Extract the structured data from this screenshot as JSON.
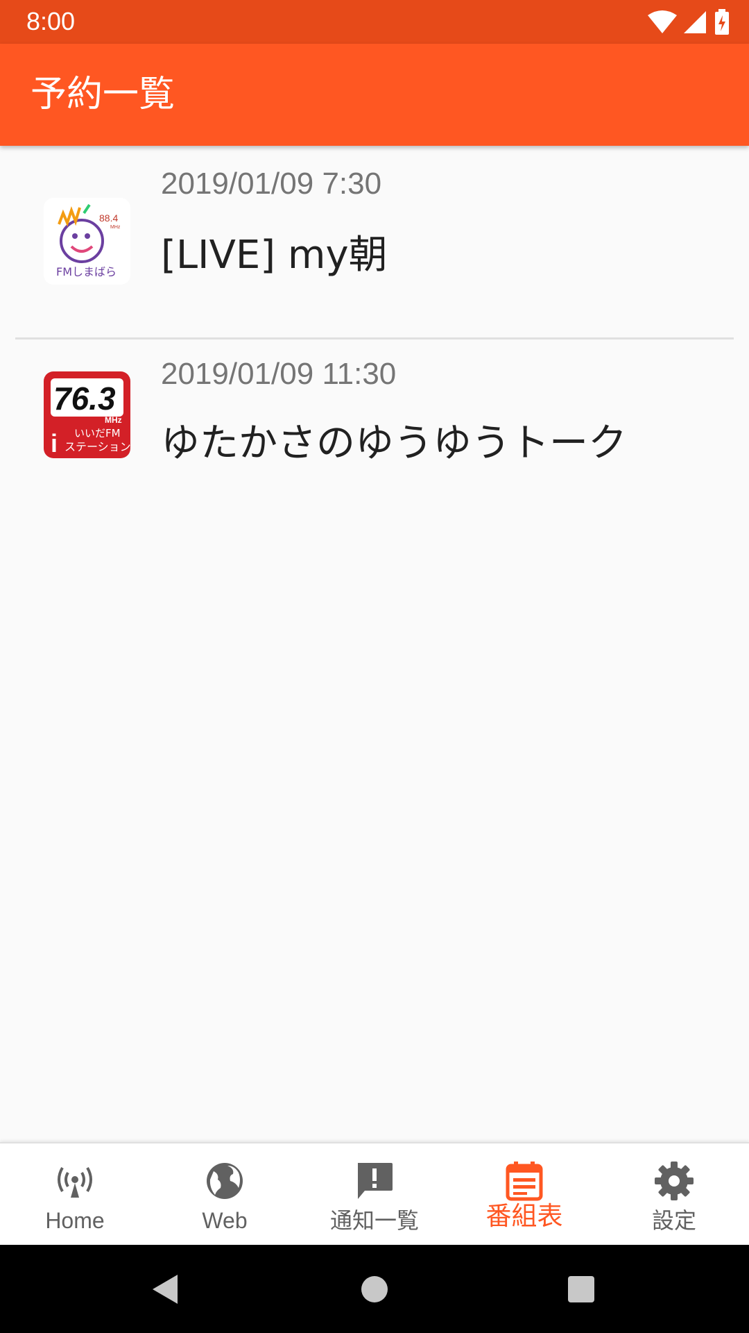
{
  "status_bar": {
    "time": "8:00"
  },
  "app_bar": {
    "title": "予約一覧"
  },
  "reservations": [
    {
      "station": "FMしまばら 88.4MHz",
      "date": "2019/01/09 7:30",
      "title": "[LIVE] my朝"
    },
    {
      "station": "いいだFM iステーション 76.3MHz",
      "date": "2019/01/09 11:30",
      "title": "ゆたかさのゆうゆうトーク"
    }
  ],
  "bottom_nav": [
    {
      "label": "Home",
      "icon": "radio-tower-icon"
    },
    {
      "label": "Web",
      "icon": "globe-icon"
    },
    {
      "label": "通知一覧",
      "icon": "alert-message-icon"
    },
    {
      "label": "番組表",
      "icon": "calendar-icon",
      "active": true
    },
    {
      "label": "設定",
      "icon": "gear-icon"
    }
  ],
  "colors": {
    "primary": "#FF5722",
    "primary_dark": "#E64A19",
    "inactive": "#616161"
  },
  "logo_text": {
    "shimabara": {
      "freq": "88.4",
      "unit": "MHz",
      "caption": "FMしまばら"
    },
    "iida": {
      "freq": "76.3",
      "unit": "MHz",
      "caption": "いいだFM",
      "subcaption": "ステーション"
    }
  }
}
